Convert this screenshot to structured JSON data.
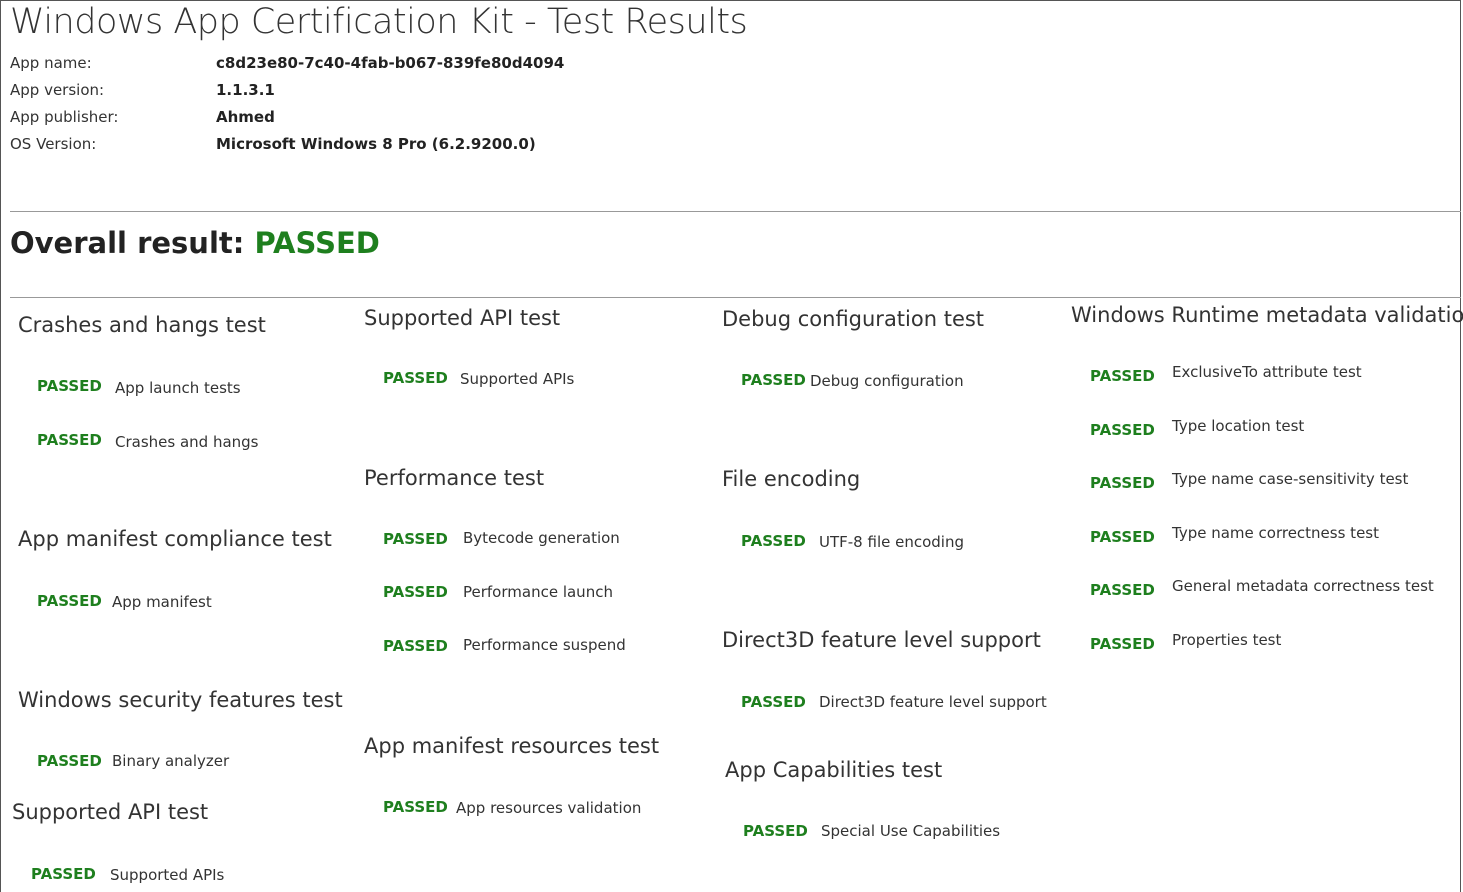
{
  "title": "Windows App Certification Kit - Test Results",
  "info": [
    {
      "label": "App name:",
      "value": "c8d23e80-7c40-4fab-b067-839fe80d4094"
    },
    {
      "label": "App version:",
      "value": "1.1.3.1"
    },
    {
      "label": "App publisher:",
      "value": "Ahmed"
    },
    {
      "label": "OS Version:",
      "value": "Microsoft Windows 8 Pro (6.2.9200.0)"
    }
  ],
  "overall": {
    "label": "Overall result:",
    "result": "PASSED"
  },
  "colors": {
    "passed": "#1e7f1e",
    "rule": "#999999"
  },
  "sections": [
    {
      "title": "Crashes and hangs test",
      "tests": [
        {
          "status": "PASSED",
          "name": "App launch tests"
        },
        {
          "status": "PASSED",
          "name": "Crashes and hangs"
        }
      ]
    },
    {
      "title": "App manifest compliance test",
      "tests": [
        {
          "status": "PASSED",
          "name": "App manifest"
        }
      ]
    },
    {
      "title": "Windows security features test",
      "tests": [
        {
          "status": "PASSED",
          "name": "Binary analyzer"
        }
      ]
    },
    {
      "title": "Supported API test",
      "tests": [
        {
          "status": "PASSED",
          "name": "Supported APIs"
        }
      ]
    },
    {
      "title": "Supported API test",
      "tests": [
        {
          "status": "PASSED",
          "name": "Supported APIs"
        }
      ]
    },
    {
      "title": "Performance test",
      "tests": [
        {
          "status": "PASSED",
          "name": "Bytecode generation"
        },
        {
          "status": "PASSED",
          "name": "Performance launch"
        },
        {
          "status": "PASSED",
          "name": "Performance suspend"
        }
      ]
    },
    {
      "title": "App manifest resources test",
      "tests": [
        {
          "status": "PASSED",
          "name": "App resources validation"
        }
      ]
    },
    {
      "title": "Debug configuration test",
      "tests": [
        {
          "status": "PASSED",
          "name": "Debug configuration"
        }
      ]
    },
    {
      "title": "File encoding",
      "tests": [
        {
          "status": "PASSED",
          "name": "UTF-8 file encoding"
        }
      ]
    },
    {
      "title": "Direct3D feature level support",
      "tests": [
        {
          "status": "PASSED",
          "name": "Direct3D feature level support"
        }
      ]
    },
    {
      "title": "App Capabilities test",
      "tests": [
        {
          "status": "PASSED",
          "name": "Special Use Capabilities"
        }
      ]
    },
    {
      "title": "Windows Runtime metadata validation",
      "tests": [
        {
          "status": "PASSED",
          "name": "ExclusiveTo attribute test"
        },
        {
          "status": "PASSED",
          "name": "Type location test"
        },
        {
          "status": "PASSED",
          "name": "Type name case-sensitivity test"
        },
        {
          "status": "PASSED",
          "name": "Type name correctness test"
        },
        {
          "status": "PASSED",
          "name": "General metadata correctness test"
        },
        {
          "status": "PASSED",
          "name": "Properties test"
        }
      ]
    }
  ]
}
